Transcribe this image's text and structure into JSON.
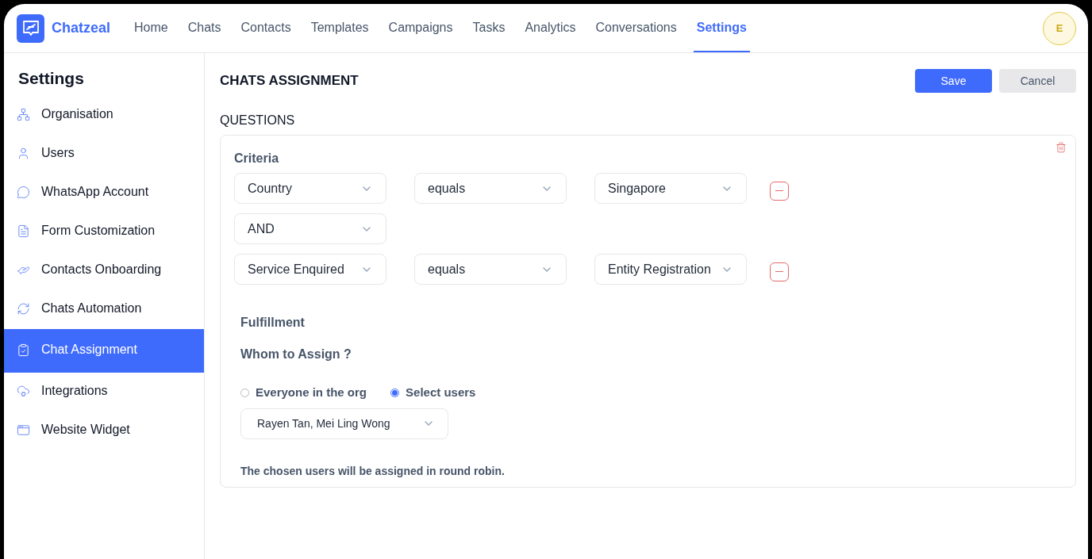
{
  "app": {
    "name": "Chatzeal"
  },
  "nav": [
    {
      "label": "Home",
      "selected": false
    },
    {
      "label": "Chats",
      "selected": false
    },
    {
      "label": "Contacts",
      "selected": false
    },
    {
      "label": "Templates",
      "selected": false
    },
    {
      "label": "Campaigns",
      "selected": false
    },
    {
      "label": "Tasks",
      "selected": false
    },
    {
      "label": "Analytics",
      "selected": false
    },
    {
      "label": "Conversations",
      "selected": false
    },
    {
      "label": "Settings",
      "selected": true
    }
  ],
  "avatar": {
    "initial": "E"
  },
  "sidebar": {
    "title": "Settings",
    "items": [
      {
        "label": "Organisation",
        "selected": false
      },
      {
        "label": "Users",
        "selected": false
      },
      {
        "label": "WhatsApp Account",
        "selected": false
      },
      {
        "label": "Form Customization",
        "selected": false
      },
      {
        "label": "Contacts Onboarding",
        "selected": false
      },
      {
        "label": "Chats Automation",
        "selected": false
      },
      {
        "label": "Chat Assignment",
        "selected": true
      },
      {
        "label": "Integrations",
        "selected": false
      },
      {
        "label": "Website Widget",
        "selected": false
      }
    ]
  },
  "page": {
    "title": "CHATS ASSIGNMENT",
    "buttons": [
      {
        "label": "Save",
        "kind": "primary"
      },
      {
        "label": "Cancel",
        "kind": "secondary"
      }
    ]
  },
  "questions": {
    "heading": "QUESTIONS",
    "criteria_label": "Criteria",
    "rows": [
      {
        "kind": "condition",
        "field": "Country",
        "operator": "equals",
        "value": "Singapore"
      },
      {
        "kind": "connector",
        "value": "AND"
      },
      {
        "kind": "condition",
        "field": "Service Enquired",
        "operator": "equals",
        "value": "Entity Registration"
      }
    ]
  },
  "fulfillment": {
    "heading": "Fulfillment",
    "question": "Whom to Assign ?",
    "options": [
      {
        "label": "Everyone in the org",
        "selected": false
      },
      {
        "label": "Select users",
        "selected": true
      }
    ],
    "users": "Rayen Tan, Mei Ling Wong",
    "note": "The chosen users will be assigned in round robin."
  }
}
